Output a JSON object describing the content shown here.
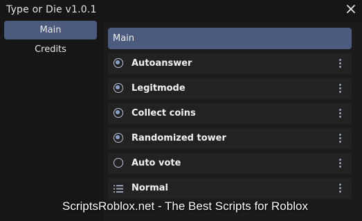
{
  "window": {
    "title": "Type or Die v1.0.1",
    "close_icon": "close-x-icon"
  },
  "sidebar": {
    "items": [
      {
        "label": "Main",
        "active": true
      },
      {
        "label": "Credits",
        "active": false
      }
    ]
  },
  "main": {
    "section_title": "Main",
    "rows": [
      {
        "label": "Autoanswer",
        "type": "toggle",
        "checked": true
      },
      {
        "label": "Legitmode",
        "type": "toggle",
        "checked": true
      },
      {
        "label": "Collect coins",
        "type": "toggle",
        "checked": true
      },
      {
        "label": "Randomized tower",
        "type": "toggle",
        "checked": true
      },
      {
        "label": "Auto vote",
        "type": "toggle",
        "checked": false
      },
      {
        "label": "Normal",
        "type": "dropdown"
      }
    ]
  },
  "watermark": "ScriptsRoblox.net - The Best Scripts for Roblox",
  "colors": {
    "accent": "#4a5b7e",
    "background": "#161616",
    "row": "#222222"
  }
}
